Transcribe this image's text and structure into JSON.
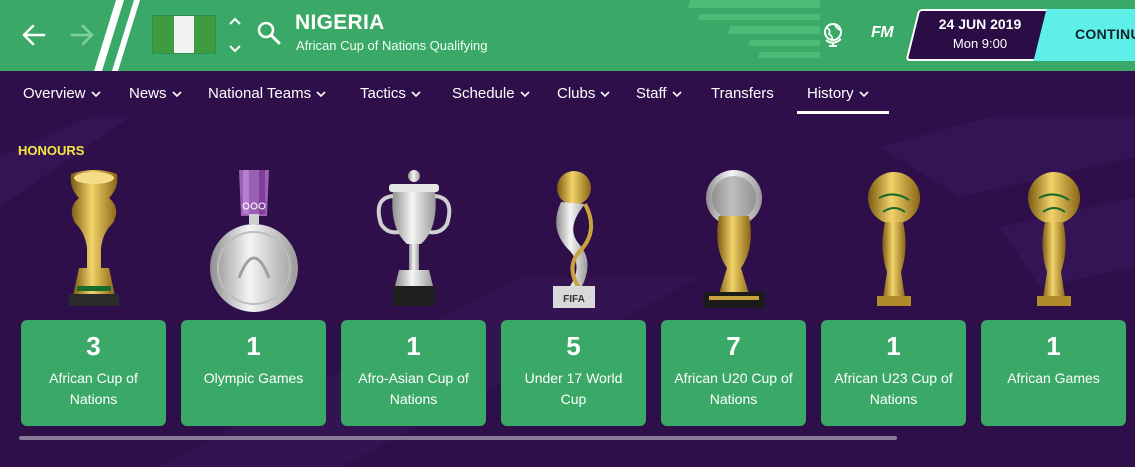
{
  "header": {
    "team_name": "NIGERIA",
    "competition": "African Cup of Nations Qualifying",
    "date": "24 JUN 2019",
    "time": "Mon 9:00",
    "fm_logo": "FM",
    "continue_label": "CONTINU",
    "icons": [
      "back-arrow-icon",
      "forward-arrow-icon",
      "up-down-chevron-icon",
      "search-icon",
      "globe-icon"
    ],
    "flag": "nigeria"
  },
  "tabs": [
    {
      "label": "Overview",
      "dropdown": true
    },
    {
      "label": "News",
      "dropdown": true
    },
    {
      "label": "National Teams",
      "dropdown": true
    },
    {
      "label": "Tactics",
      "dropdown": true
    },
    {
      "label": "Schedule",
      "dropdown": true
    },
    {
      "label": "Clubs",
      "dropdown": true
    },
    {
      "label": "Staff",
      "dropdown": true
    },
    {
      "label": "Transfers",
      "dropdown": false
    },
    {
      "label": "History",
      "dropdown": true,
      "active": true
    }
  ],
  "honours": {
    "title": "HONOURS",
    "items": [
      {
        "count": "3",
        "label": "African Cup of Nations",
        "trophy": "afcon-trophy"
      },
      {
        "count": "1",
        "label": "Olympic Games",
        "trophy": "olympic-medal"
      },
      {
        "count": "1",
        "label": "Afro-Asian Cup of Nations",
        "trophy": "cup-trophy"
      },
      {
        "count": "5",
        "label": "Under 17 World Cup",
        "trophy": "fifa-u17-trophy"
      },
      {
        "count": "7",
        "label": "African U20 Cup of Nations",
        "trophy": "u20-trophy"
      },
      {
        "count": "1",
        "label": "African U23 Cup of Nations",
        "trophy": "u23-trophy"
      },
      {
        "count": "1",
        "label": "African Games",
        "trophy": "african-games-trophy"
      }
    ]
  },
  "colors": {
    "header_green": "#3aa866",
    "background_purple": "#2e0f4a",
    "continue_cyan": "#5ef0e8",
    "honours_yellow": "#f5e93c"
  }
}
